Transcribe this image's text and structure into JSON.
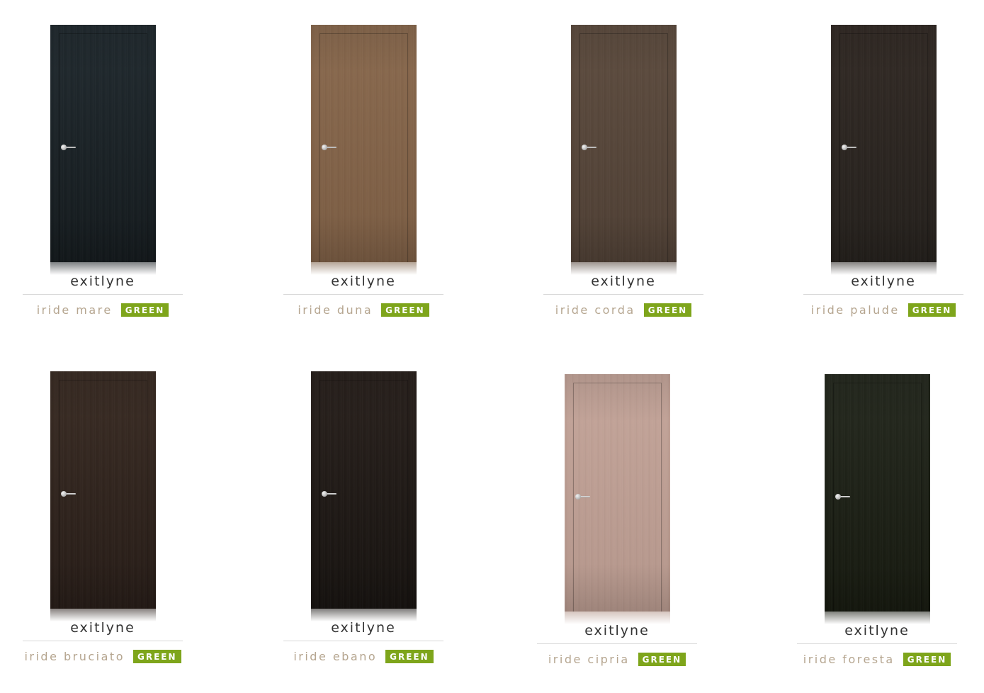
{
  "badge_color": "#7ea51b",
  "products": [
    {
      "model": "exitlyne",
      "finish": "iride mare",
      "badge": "GREEN",
      "color_top": "#222b30",
      "color_bottom": "#141a1d"
    },
    {
      "model": "exitlyne",
      "finish": "iride duna",
      "badge": "GREEN",
      "color_top": "#8a6a4f",
      "color_bottom": "#7a5c43"
    },
    {
      "model": "exitlyne",
      "finish": "iride corda",
      "badge": "GREEN",
      "color_top": "#5e4d40",
      "color_bottom": "#4e3f34"
    },
    {
      "model": "exitlyne",
      "finish": "iride palude",
      "badge": "GREEN",
      "color_top": "#332b26",
      "color_bottom": "#24201c"
    },
    {
      "model": "exitlyne",
      "finish": "iride bruciato",
      "badge": "GREEN",
      "color_top": "#3b2d25",
      "color_bottom": "#261c17"
    },
    {
      "model": "exitlyne",
      "finish": "iride ebano",
      "badge": "GREEN",
      "color_top": "#2a221e",
      "color_bottom": "#171310"
    },
    {
      "model": "exitlyne",
      "finish": "iride cipria",
      "badge": "GREEN",
      "color_top": "#c4a59a",
      "color_bottom": "#b4968b"
    },
    {
      "model": "exitlyne",
      "finish": "iride foresta",
      "badge": "GREEN",
      "color_top": "#262a20",
      "color_bottom": "#16190f"
    }
  ]
}
